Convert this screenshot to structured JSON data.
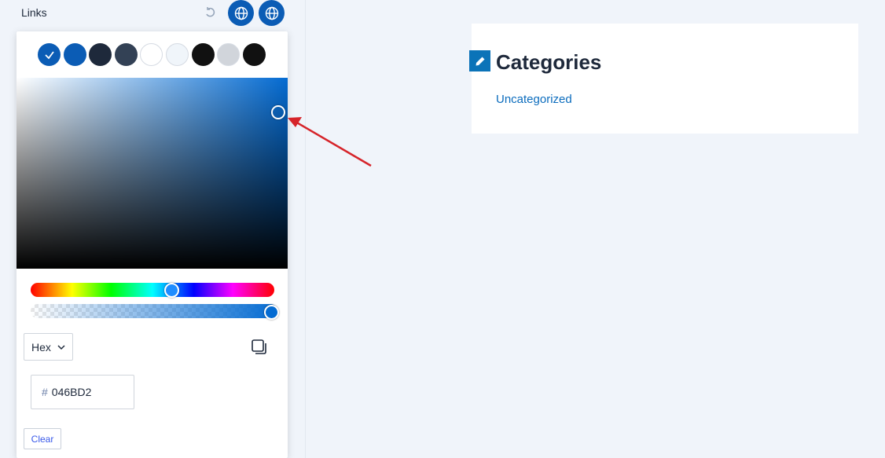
{
  "panel": {
    "label": "Links"
  },
  "picker": {
    "swatches": [
      {
        "color": "#0b5cb5",
        "selected": true
      },
      {
        "color": "#0b5cb5",
        "selected": false
      },
      {
        "color": "#1e293b",
        "selected": false
      },
      {
        "color": "#334155",
        "selected": false
      },
      {
        "color": "#ffffff",
        "selected": false
      },
      {
        "color": "#f0f5fa",
        "selected": false
      },
      {
        "color": "#111111",
        "selected": false
      },
      {
        "color": "#d1d5db",
        "selected": false
      },
      {
        "color": "#111111",
        "selected": false
      }
    ],
    "format": "Hex",
    "hex_prefix": "#",
    "hex_value": "046BD2",
    "clear_label": "Clear"
  },
  "preview": {
    "title": "Categories",
    "link": "Uncategorized"
  },
  "colors": {
    "accent": "#046bd2",
    "link": "#0b6cbd",
    "annotation_arrow": "#d6242a"
  }
}
